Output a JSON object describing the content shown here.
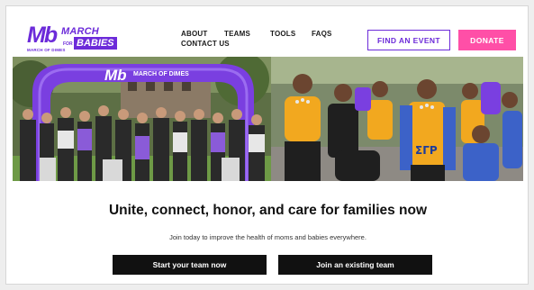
{
  "logo": {
    "mark": "Mb",
    "word_march": "MARCH",
    "word_for": "FOR",
    "word_babies": "BABIES",
    "org_name": "MARCH OF DIMES"
  },
  "nav": {
    "items": [
      "ABOUT",
      "TEAMS",
      "TOOLS",
      "FAQS",
      "CONTACT US"
    ]
  },
  "actions": {
    "find_event": "FIND AN EVENT",
    "donate": "DONATE"
  },
  "hero": {
    "arch_logo_text": "Mb",
    "arch_text": "MARCH OF DIMES",
    "shirt_letters": "ΣΓΡ"
  },
  "content": {
    "headline": "Unite, connect, honor, and care for families now",
    "subline": "Join today to improve the health of moms and babies everywhere.",
    "start_team": "Start your team now",
    "join_team": "Join an existing team"
  },
  "colors": {
    "brand_purple": "#6c2bd9",
    "donate_pink": "#ff4fa7",
    "button_dark": "#111111"
  }
}
